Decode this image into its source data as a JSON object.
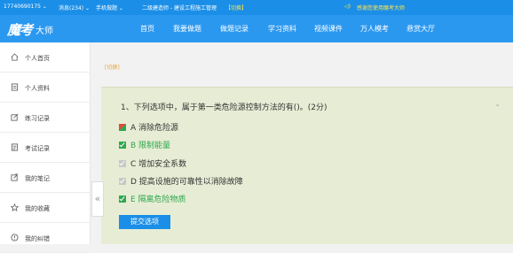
{
  "topbar": {
    "phone": "17740690175 ⌄",
    "messages": "消息(234) ⌄",
    "mobile": "手机做题 ⌄",
    "course": "二级建造师 - 建设工程施工管理",
    "switch": "【切换】",
    "notice": "感谢您使用魔考大师",
    "speaker_icon": "speaker-icon"
  },
  "brand": {
    "logo": "魔考",
    "suffix": "大师"
  },
  "nav": {
    "items": [
      "首页",
      "我要做题",
      "做题记录",
      "学习资料",
      "视频课件",
      "万人模考",
      "悬赏大厅"
    ]
  },
  "sidebar": {
    "items": [
      {
        "label": "个人首页",
        "icon": "home-icon"
      },
      {
        "label": "个人资料",
        "icon": "profile-icon"
      },
      {
        "label": "练习记录",
        "icon": "practice-icon"
      },
      {
        "label": "考试记录",
        "icon": "exam-icon"
      },
      {
        "label": "我的笔记",
        "icon": "notes-icon"
      },
      {
        "label": "我的收藏",
        "icon": "star-icon"
      },
      {
        "label": "我的纠错",
        "icon": "error-icon"
      }
    ]
  },
  "main": {
    "switch_link": "[切换]",
    "question": {
      "title": "1、下列选项中，属于第一类危险源控制方法的有()。(2分)",
      "options": [
        {
          "text": "A 消除危险源",
          "state": "wrong"
        },
        {
          "text": "B 限制能量",
          "state": "correct"
        },
        {
          "text": "C 增加安全系数",
          "state": "unchecked"
        },
        {
          "text": "D 提高设施的可靠性以消除故障",
          "state": "unchecked"
        },
        {
          "text": "E 隔离危险物质",
          "state": "correct"
        }
      ],
      "submit_label": "提交选项"
    }
  },
  "colors": {
    "primary": "#2b98f0",
    "correct": "#2fa84f",
    "wrong": "#e04c3c",
    "panel": "#e7edd5",
    "accent": "#e8a23a"
  }
}
